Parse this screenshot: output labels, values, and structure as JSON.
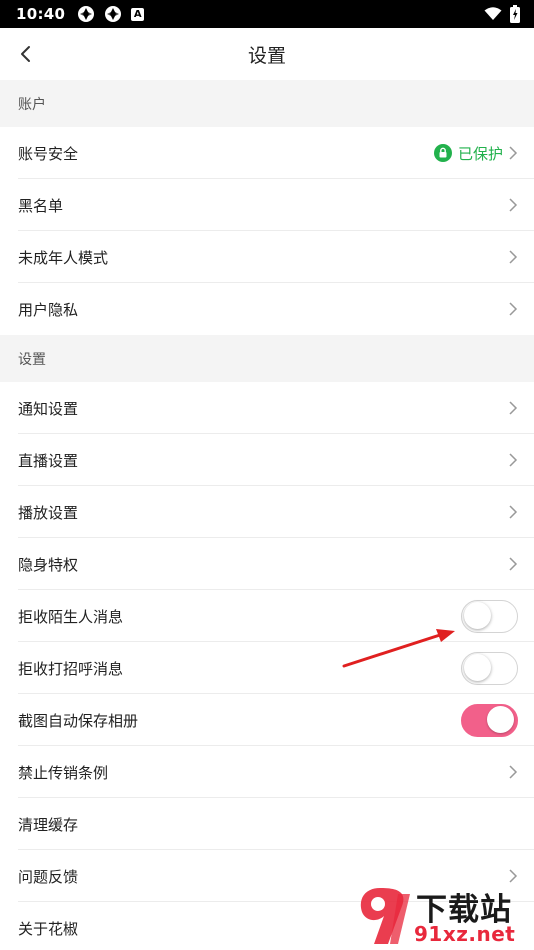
{
  "status_bar": {
    "time": "10:40",
    "battery_icon_letter": "A"
  },
  "header": {
    "title": "设置"
  },
  "sections": [
    {
      "title": "账户",
      "items": [
        {
          "label": "账号安全",
          "status": "已保护"
        },
        {
          "label": "黑名单"
        },
        {
          "label": "未成年人模式"
        },
        {
          "label": "用户隐私"
        }
      ]
    },
    {
      "title": "设置",
      "items": [
        {
          "label": "通知设置"
        },
        {
          "label": "直播设置"
        },
        {
          "label": "播放设置"
        },
        {
          "label": "隐身特权"
        },
        {
          "label": "拒收陌生人消息",
          "toggle": false
        },
        {
          "label": "拒收打招呼消息",
          "toggle": false
        },
        {
          "label": "截图自动保存相册",
          "toggle": true
        },
        {
          "label": "禁止传销条例"
        },
        {
          "label": "清理缓存"
        },
        {
          "label": "问题反馈"
        },
        {
          "label": "关于花椒"
        }
      ]
    }
  ],
  "colors": {
    "accent_pink": "#f2608a",
    "protected_green": "#22b14c",
    "annotation_red": "#e02020"
  },
  "watermark": {
    "line1": "下载站",
    "line2": "91xz.net"
  }
}
